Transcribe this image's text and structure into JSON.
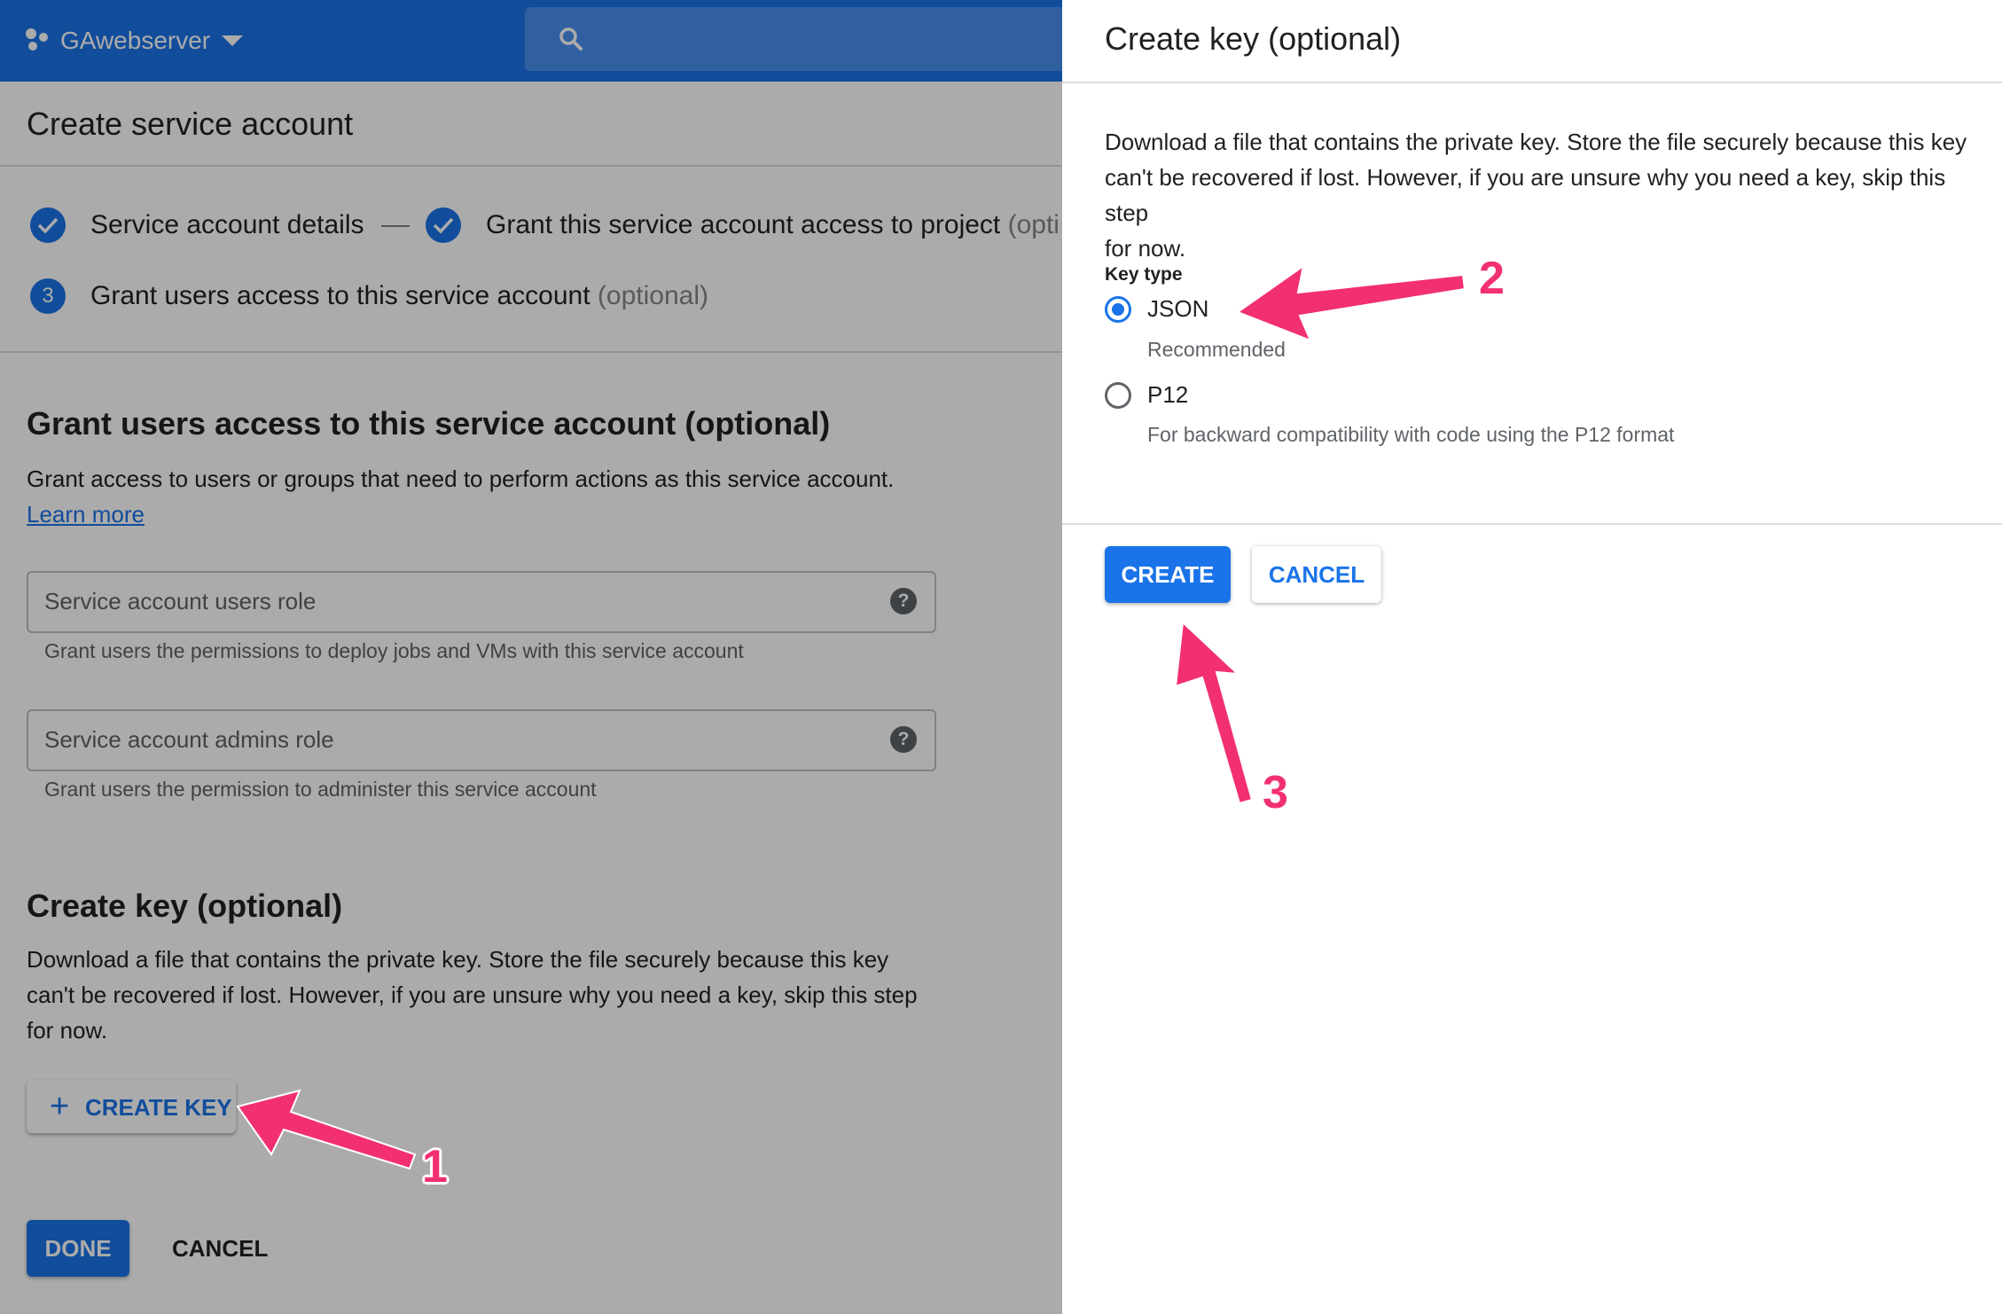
{
  "topbar": {
    "project_name": "GAwebserver",
    "project_icon": "project-dots-icon",
    "search_icon": "search-icon"
  },
  "page": {
    "title": "Create service account",
    "steps": [
      {
        "label": "Service account details",
        "state": "done"
      },
      {
        "label": "Grant this service account access to project",
        "optional": "(opti",
        "state": "done"
      },
      {
        "number": "3",
        "label": "Grant users access to this service account",
        "optional": "(optional)",
        "state": "current"
      }
    ]
  },
  "grant_section": {
    "heading": "Grant users access to this service account (optional)",
    "description": "Grant access to users or groups that need to perform actions as this service account.",
    "learn_more": "Learn more",
    "fields": [
      {
        "placeholder": "Service account users role",
        "helper": "Grant users the permissions to deploy jobs and VMs with this service account",
        "help_glyph": "?"
      },
      {
        "placeholder": "Service account admins role",
        "helper": "Grant users the permission to administer this service account",
        "help_glyph": "?"
      }
    ]
  },
  "key_section": {
    "heading": "Create key (optional)",
    "description_lines": [
      "Download a file that contains the private key. Store the file securely because this key",
      "can't be recovered if lost. However, if you are unsure why you need a key, skip this step",
      "for now."
    ],
    "create_key_plus": "+",
    "create_key_label": "CREATE KEY"
  },
  "footer": {
    "done_label": "DONE",
    "cancel_label": "CANCEL"
  },
  "panel": {
    "title": "Create key (optional)",
    "description_lines": [
      "Download a file that contains the private key. Store the file securely because this key",
      "can't be recovered if lost. However, if you are unsure why you need a key, skip this step",
      "for now."
    ],
    "key_type_label": "Key type",
    "options": [
      {
        "label": "JSON",
        "sub": "Recommended",
        "selected": true
      },
      {
        "label": "P12",
        "sub": "For backward compatibility with code using the P12 format",
        "selected": false
      }
    ],
    "create_label": "CREATE",
    "cancel_label": "CANCEL"
  },
  "annotations": {
    "color": "#f2306f",
    "numbers": [
      "1",
      "2",
      "3"
    ]
  },
  "colors": {
    "primary": "#1a73e8",
    "overlay": "rgba(0,0,0,0.33)"
  }
}
